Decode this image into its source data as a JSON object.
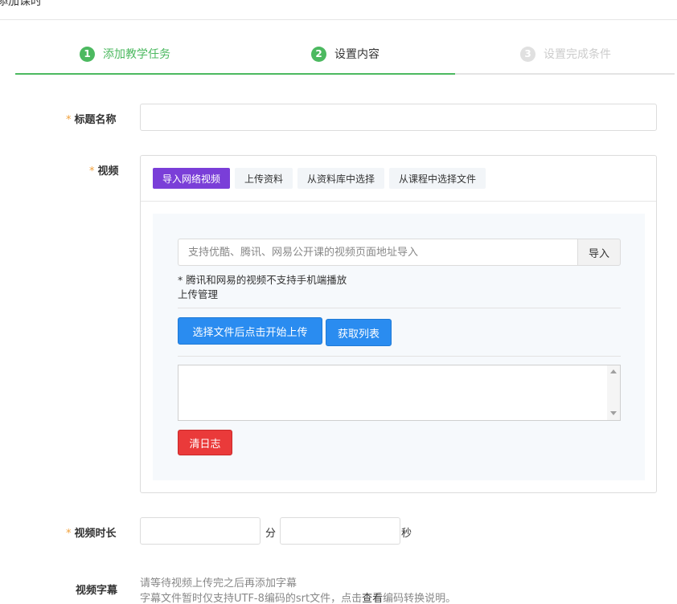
{
  "header": {
    "title": "添加课时"
  },
  "steps": [
    {
      "num": "1",
      "label": "添加教学任务"
    },
    {
      "num": "2",
      "label": "设置内容"
    },
    {
      "num": "3",
      "label": "设置完成条件"
    }
  ],
  "form": {
    "title_label": "标题名称",
    "title_value": "",
    "video_label": "视频",
    "duration_label": "视频时长",
    "duration_min_unit": "分",
    "duration_sec_unit": "秒",
    "subtitle_label": "视频字幕",
    "subtitle_tip1": "请等待视频上传完之后再添加字幕",
    "subtitle_tip2_a": "字幕文件暂时仅支持UTF-8编码的srt文件，点击",
    "subtitle_tip2_link": "查看",
    "subtitle_tip2_b": "编码转换说明。",
    "required_mark": "*"
  },
  "video": {
    "tabs": [
      {
        "label": "导入网络视频",
        "active": true
      },
      {
        "label": "上传资料",
        "active": false
      },
      {
        "label": "从资料库中选择",
        "active": false
      },
      {
        "label": "从课程中选择文件",
        "active": false
      }
    ],
    "url_placeholder": "支持优酷、腾讯、网易公开课的视频页面地址导入",
    "import_label": "导入",
    "note": "* 腾讯和网易的视频不支持手机端播放",
    "upload_manage": "上传管理",
    "select_upload_label": "选择文件后点击开始上传",
    "get_list_label": "获取列表",
    "clear_log_label": "清日志"
  },
  "colors": {
    "green": "#4cb960",
    "purple": "#7a3ed8",
    "blue": "#2a8cf0",
    "red": "#ea3a3a",
    "required": "#f0a03c"
  }
}
